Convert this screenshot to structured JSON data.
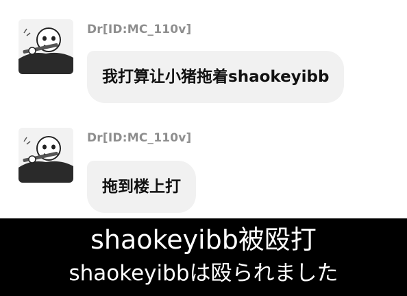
{
  "messages": [
    {
      "sender": "Dr[ID:MC_110v]",
      "text": "我打算让小猪拖着shaokeyibb",
      "avatar_icon": "skeleton-flute-avatar-icon"
    },
    {
      "sender": "Dr[ID:MC_110v]",
      "text": "拖到楼上打",
      "avatar_icon": "skeleton-flute-avatar-icon"
    }
  ],
  "subtitles": {
    "chinese": "shaokeyibb被殴打",
    "japanese": "shaokeyibbは殴られました"
  },
  "colors": {
    "bubble": "#f1f1f1",
    "sender": "#8e8e8e",
    "subtitle_bar": "#000000",
    "subtitle_text": "#ffffff"
  }
}
